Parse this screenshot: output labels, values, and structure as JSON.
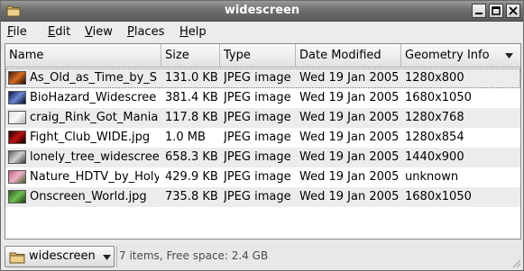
{
  "window": {
    "title": "widescreen"
  },
  "menu": {
    "items": [
      {
        "label_u": "F",
        "label_rest": "ile"
      },
      {
        "label_u": "E",
        "label_rest": "dit"
      },
      {
        "label_u": "V",
        "label_rest": "iew"
      },
      {
        "label_u": "P",
        "label_rest": "laces"
      },
      {
        "label_u": "H",
        "label_rest": "elp"
      }
    ]
  },
  "table": {
    "headers": [
      "Name",
      "Size",
      "Type",
      "Date Modified",
      "Geometry Info"
    ],
    "sorted_column": "Geometry Info",
    "sort_direction": "descending",
    "rows": [
      {
        "name": "As_Old_as_Time_by_S",
        "size": "131.0 KB",
        "type": "JPEG image",
        "date": "Wed 19 Jan 2005",
        "geometry": "1280x800",
        "thumb_colors": [
          "#3a1a0a",
          "#d86a20",
          "#1a0a05"
        ]
      },
      {
        "name": "BioHazard_Widescree",
        "size": "381.4 KB",
        "type": "JPEG image",
        "date": "Wed 19 Jan 2005",
        "geometry": "1680x1050",
        "thumb_colors": [
          "#0a0f3a",
          "#6a88d8",
          "#050a20"
        ]
      },
      {
        "name": "craig_Rink_Got_Mania",
        "size": "117.8 KB",
        "type": "JPEG image",
        "date": "Wed 19 Jan 2005",
        "geometry": "1280x768",
        "thumb_colors": [
          "#e0e0e0",
          "#f8f8f8",
          "#b0b0b0"
        ]
      },
      {
        "name": "Fight_Club_WIDE.jpg",
        "size": "1.0 MB",
        "type": "JPEG image",
        "date": "Wed 19 Jan 2005",
        "geometry": "1280x854",
        "thumb_colors": [
          "#1a0000",
          "#c01010",
          "#000000"
        ]
      },
      {
        "name": "lonely_tree_widescree",
        "size": "658.3 KB",
        "type": "JPEG image",
        "date": "Wed 19 Jan 2005",
        "geometry": "1440x900",
        "thumb_colors": [
          "#5a5a5a",
          "#d0d0d0",
          "#3a3a3a"
        ]
      },
      {
        "name": "Nature_HDTV_by_Holy",
        "size": "429.9 KB",
        "type": "JPEG image",
        "date": "Wed 19 Jan 2005",
        "geometry": "unknown",
        "thumb_colors": [
          "#c06080",
          "#f0b0c8",
          "#406020"
        ]
      },
      {
        "name": "Onscreen_World.jpg",
        "size": "735.8 KB",
        "type": "JPEG image",
        "date": "Wed 19 Jan 2005",
        "geometry": "1680x1050",
        "thumb_colors": [
          "#2a5a20",
          "#70c050",
          "#1a3a10"
        ]
      }
    ]
  },
  "statusbar": {
    "location": "widescreen",
    "info": "7 items, Free space: 2.4 GB"
  },
  "icons": {
    "title_icon": "folder-icon",
    "minimize": "minimize-icon",
    "maximize": "maximize-icon",
    "close": "close-icon",
    "sort": "sort-descending-icon",
    "location_folder": "folder-icon",
    "location_dropdown": "chevron-down-icon"
  },
  "colors": {
    "titlebar": "#6f6f6f",
    "row_alt": "#ececec",
    "folder": "#d8b868"
  }
}
